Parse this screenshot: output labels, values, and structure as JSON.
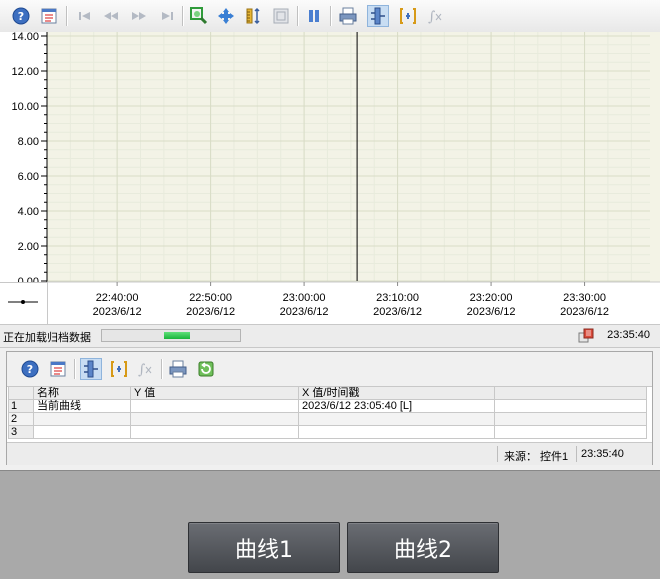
{
  "chart_data": {
    "type": "line",
    "ylim": [
      0,
      14
    ],
    "y_ticks": [
      "0.00",
      "2.00",
      "4.00",
      "6.00",
      "8.00",
      "10.00",
      "12.00",
      "14.00"
    ],
    "x_ticks": [
      {
        "time": "22:40:00",
        "date": "2023/6/12"
      },
      {
        "time": "22:50:00",
        "date": "2023/6/12"
      },
      {
        "time": "23:00:00",
        "date": "2023/6/12"
      },
      {
        "time": "23:10:00",
        "date": "2023/6/12"
      },
      {
        "time": "23:20:00",
        "date": "2023/6/12"
      },
      {
        "time": "23:30:00",
        "date": "2023/6/12"
      }
    ],
    "xlim_minutes": [
      -7.5,
      57
    ],
    "cursor_minute": 25.67,
    "grid": true,
    "series": []
  },
  "status": {
    "loading_text": "正在加载归档数据",
    "progress": 0.19,
    "time": "23:35:40"
  },
  "table": {
    "headers": [
      "",
      "名称",
      "Y 值",
      "X 值/时间戳",
      ""
    ],
    "rows": [
      {
        "num": "1",
        "name": "当前曲线",
        "y": "",
        "x": "2023/6/12 23:05:40 [L]"
      },
      {
        "num": "2",
        "name": "",
        "y": "",
        "x": ""
      },
      {
        "num": "3",
        "name": "",
        "y": "",
        "x": ""
      }
    ]
  },
  "footer": {
    "source": "来源： 控件1",
    "time": "23:35:40"
  },
  "buttons": {
    "curve1": "曲线1",
    "curve2": "曲线2"
  },
  "colors": {
    "plot_bg": "#f3f3e6",
    "grid_major": "#d8dcc6",
    "grid_minor": "#e8ebdc",
    "cursor": "#000000",
    "progress": "#18b43a"
  }
}
